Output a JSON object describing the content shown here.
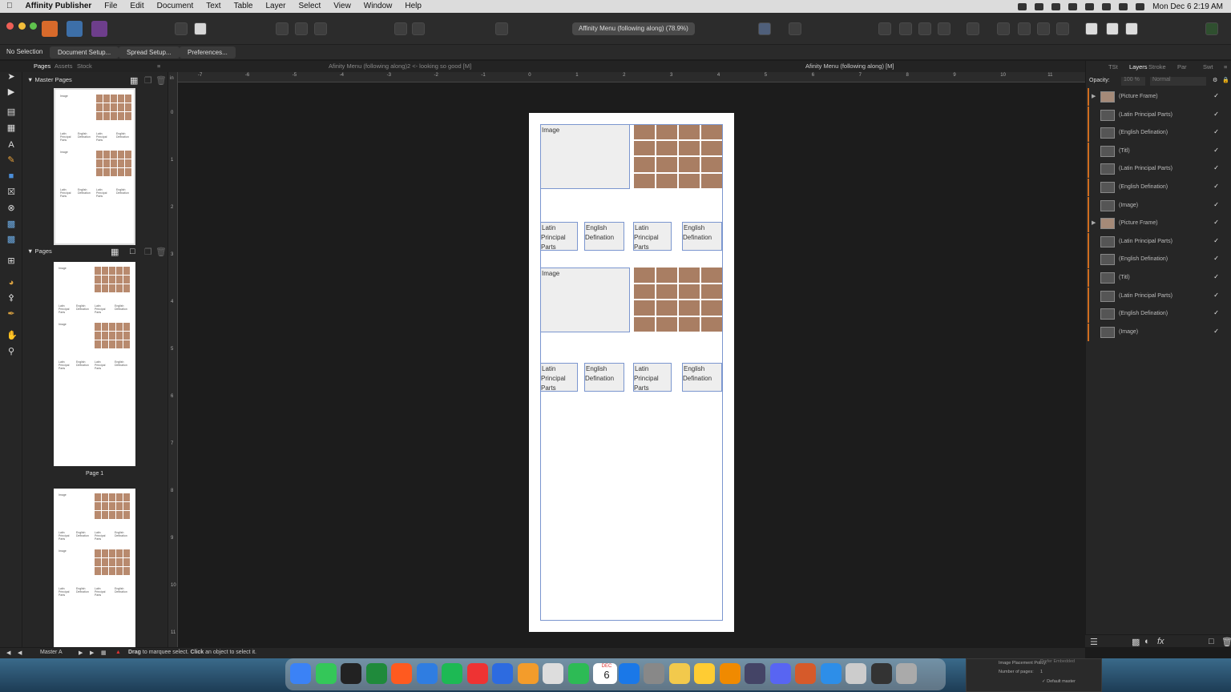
{
  "menubar": {
    "app_name": "Affinity Publisher",
    "menus": [
      "File",
      "Edit",
      "Document",
      "Text",
      "Table",
      "Layer",
      "Select",
      "View",
      "Window",
      "Help"
    ],
    "clock": "Mon Dec 6  2:19 AM"
  },
  "toolbar": {
    "document_tab": "Affinity Menu (following along) (78.9%)"
  },
  "context": {
    "selection": "No Selection",
    "buttons": [
      "Document Setup...",
      "Spread Setup...",
      "Preferences..."
    ]
  },
  "left_tabs": [
    "Pages",
    "Assets",
    "Stock"
  ],
  "center_tabs": [
    "Afinity Menu (following along)2 <- looking so good [M]",
    "Afinity Menu (following along) [M]"
  ],
  "ruler_unit": "in",
  "ruler_ticks": [
    "-7",
    "-6",
    "-5",
    "-4",
    "-3",
    "-2",
    "-1",
    "0",
    "1",
    "2",
    "3",
    "4",
    "5",
    "6",
    "7",
    "8",
    "9",
    "10",
    "11"
  ],
  "pages_panel": {
    "master_pages_title": "Master Pages",
    "pages_title": "Pages",
    "page1_label": "Page 1"
  },
  "page_frames": {
    "image_label": "Image",
    "latin_label": "Latin Principal Parts",
    "english_label": "English Defination"
  },
  "right_tabs": [
    "TSt",
    "Layers",
    "Stroke",
    "Par",
    "Swt"
  ],
  "opacity": {
    "label": "Opacity:",
    "value": "100 %",
    "blend": "Normal"
  },
  "layers": [
    {
      "name": "(Picture Frame)",
      "kind": "picture",
      "expand": true
    },
    {
      "name": "(Latin Principal Parts)",
      "kind": "text"
    },
    {
      "name": "(English Defination)",
      "kind": "text"
    },
    {
      "name": "(Titl)",
      "kind": "text"
    },
    {
      "name": "(Latin Principal Parts)",
      "kind": "text"
    },
    {
      "name": "(English Defination)",
      "kind": "text"
    },
    {
      "name": "(Image)",
      "kind": "text"
    },
    {
      "name": "(Picture Frame)",
      "kind": "picture",
      "expand": true
    },
    {
      "name": "(Latin Principal Parts)",
      "kind": "text"
    },
    {
      "name": "(English Defination)",
      "kind": "text"
    },
    {
      "name": "(Titl)",
      "kind": "text"
    },
    {
      "name": "(Latin Principal Parts)",
      "kind": "text"
    },
    {
      "name": "(English Defination)",
      "kind": "text"
    },
    {
      "name": "(Image)",
      "kind": "text"
    }
  ],
  "statusbar": {
    "master": "Master A",
    "hint_bold1": "Drag",
    "hint1": "to marquee select.",
    "hint_bold2": "Click",
    "hint2": "an object to select it."
  },
  "popup": {
    "number_of_pages": "Number of pages:",
    "pages_value": "1",
    "default_master": "Default master",
    "facing": "Image Placement Policy:",
    "facing_value": "Prefer Embedded"
  },
  "dock_calendar": {
    "month": "DEC",
    "day": "6"
  }
}
